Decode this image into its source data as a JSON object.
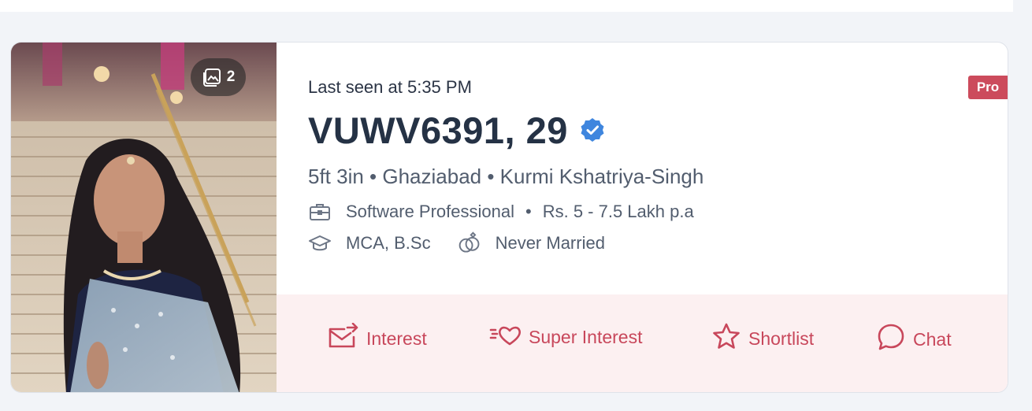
{
  "profile": {
    "last_seen": "Last seen at 5:35 PM",
    "name_age": "VUWV6391, 29",
    "details": "5ft 3in • Ghaziabad • Kurmi Kshatriya-Singh",
    "profession": "Software Professional",
    "income": "Rs. 5 - 7.5 Lakh p.a",
    "separator": "•",
    "education": "MCA, B.Sc",
    "marital_status": "Never Married",
    "photo_count": "2",
    "badge": "Pro"
  },
  "actions": {
    "interest": "Interest",
    "super_interest": "Super Interest",
    "shortlist": "Shortlist",
    "chat": "Chat"
  },
  "icons": {
    "photo_count": "gallery-icon",
    "verified": "verified-badge-icon",
    "profession": "briefcase-icon",
    "education": "graduation-cap-icon",
    "marital": "rings-icon",
    "interest": "mail-send-icon",
    "super_interest": "heart-icon",
    "shortlist": "star-icon",
    "chat": "chat-bubble-icon"
  },
  "colors": {
    "accent": "#c8475b",
    "badge_bg": "#cc4b5c",
    "verified": "#3f86de",
    "action_bg": "#fcf0f1"
  }
}
